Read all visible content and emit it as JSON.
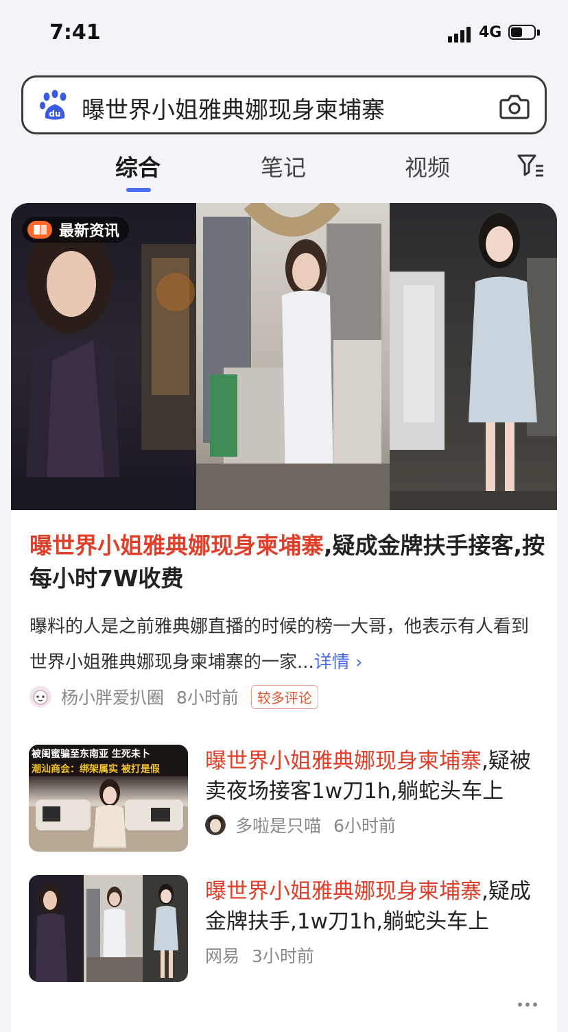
{
  "status": {
    "time": "7:41",
    "network": "4G"
  },
  "search": {
    "query": "曝世界小姐雅典娜现身柬埔寨"
  },
  "tabs": [
    {
      "label": "综合"
    },
    {
      "label": "笔记"
    },
    {
      "label": "视频"
    }
  ],
  "top_result": {
    "badge": "最新资讯",
    "title_highlight": "曝世界小姐雅典娜现身柬埔寨",
    "title_rest": ",疑成金牌扶手接客,按每小时7W收费",
    "summary": "曝料的人是之前雅典娜直播的时候的榜一大哥，他表示有人看到世界小姐雅典娜现身柬埔寨的一家...",
    "detail_label": "详情 ›",
    "source": "杨小胖爱扒圈",
    "time": "8小时前",
    "tag": "较多评论"
  },
  "results": [
    {
      "title_highlight": "曝世界小姐雅典娜现身柬埔寨",
      "title_rest": ",疑被卖夜场接客1w刀1h,躺蛇头车上",
      "source": "多啦是只喵",
      "time": "6小时前",
      "thumb_caption_1": "被闺蜜骗至东南亚 生死未卜",
      "thumb_caption_2": "潮汕商会：绑架属实 被打是假"
    },
    {
      "title_highlight": "曝世界小姐雅典娜现身柬埔寨",
      "title_rest": ",疑成金牌扶手,1w刀1h,躺蛇头车上",
      "source": "网易",
      "time": "3小时前"
    }
  ],
  "icons": {
    "logo": "baidu-paw-icon",
    "camera": "camera-icon",
    "filter": "filter-icon",
    "more": "more-dots-icon"
  },
  "colors": {
    "accent": "#4e6ef2",
    "highlight": "#e0402b"
  }
}
